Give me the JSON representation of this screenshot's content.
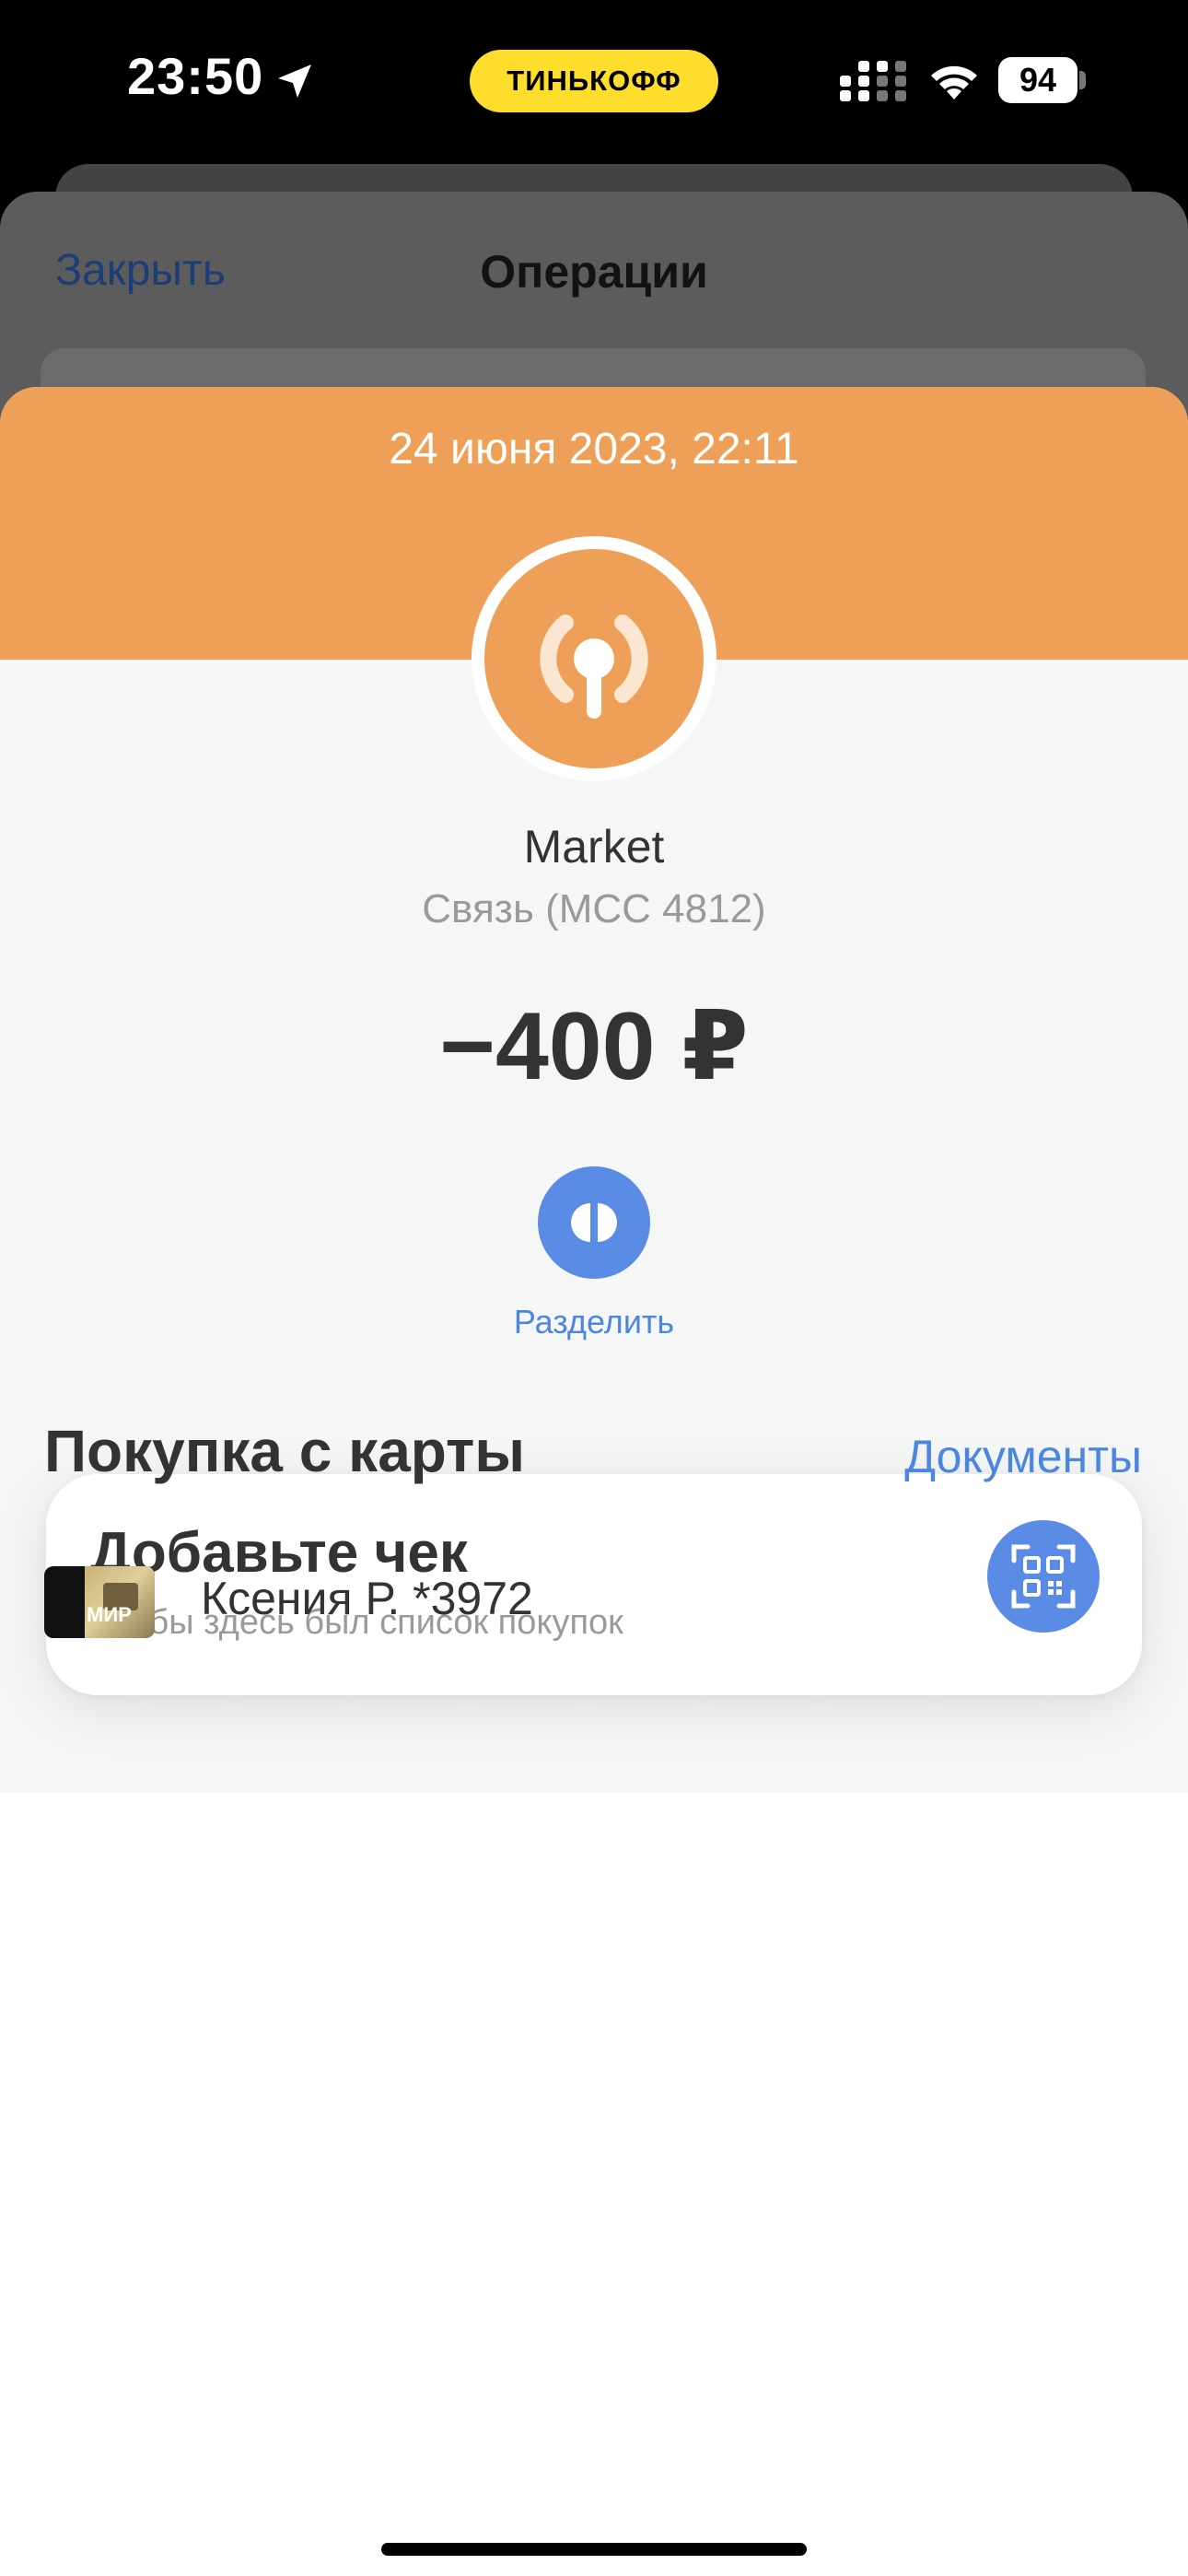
{
  "status_bar": {
    "time": "23:50",
    "carrier_badge": "ТИНЬКОФФ",
    "battery": "94",
    "icons": [
      "location-arrow-icon",
      "signal-icon",
      "wifi-icon",
      "battery-icon"
    ]
  },
  "background_sheet": {
    "close_label": "Закрыть",
    "title": "Операции"
  },
  "operation": {
    "datetime": "24 июня 2023, 22:11",
    "merchant": "Market",
    "category": "Связь (MCC 4812)",
    "amount": "−400 ₽",
    "header_color": "#eea059",
    "logo_icon": "radio-broadcast-icon",
    "split_label": "Разделить",
    "split_icon": "split-icon"
  },
  "receipt": {
    "title": "Добавьте чек",
    "subtitle": "Чтобы здесь был список покупок",
    "qr_icon": "qr-scan-icon"
  },
  "purchase": {
    "title": "Покупка с карты",
    "documents_label": "Документы",
    "card_brand": "МИР",
    "card_holder": "Ксения Р. *3972"
  },
  "colors": {
    "accent_blue": "#5a8be5",
    "link_blue": "#4c86df",
    "brand_yellow": "#ffdd2d"
  }
}
